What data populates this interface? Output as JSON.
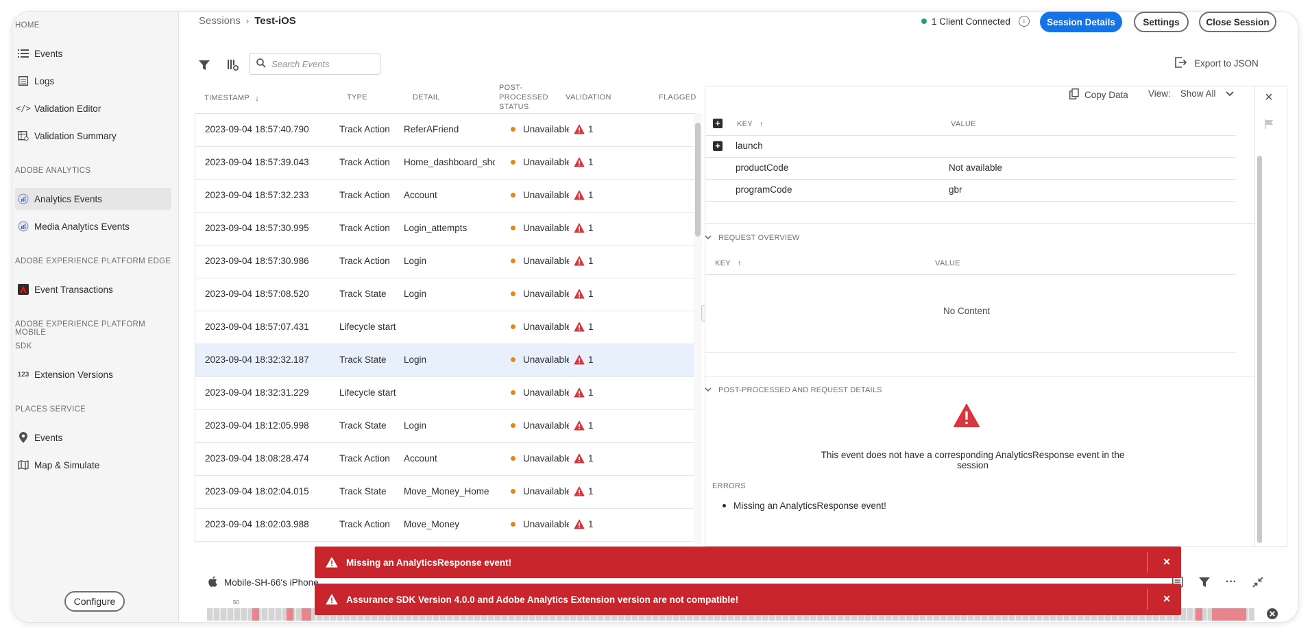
{
  "sidebar": {
    "sections": [
      {
        "title": "HOME",
        "items": [
          {
            "label": "Events",
            "icon": "list-icon"
          },
          {
            "label": "Logs",
            "icon": "log-icon"
          },
          {
            "label": "Validation Editor",
            "icon": "code-icon"
          },
          {
            "label": "Validation Summary",
            "icon": "summary-icon"
          }
        ]
      },
      {
        "title": "ADOBE ANALYTICS",
        "items": [
          {
            "label": "Analytics Events",
            "icon": "analytics-icon",
            "active": true
          },
          {
            "label": "Media Analytics Events",
            "icon": "media-analytics-icon"
          }
        ]
      },
      {
        "title": "ADOBE EXPERIENCE PLATFORM EDGE",
        "items": [
          {
            "label": "Event Transactions",
            "icon": "adobe-logo-icon"
          }
        ]
      },
      {
        "title": "ADOBE EXPERIENCE PLATFORM MOBILE",
        "title2": "SDK",
        "items": [
          {
            "label": "Extension Versions",
            "icon": "123-icon"
          }
        ]
      },
      {
        "title": "PLACES SERVICE",
        "items": [
          {
            "label": "Events",
            "icon": "pin-icon"
          },
          {
            "label": "Map & Simulate",
            "icon": "map-icon"
          }
        ]
      }
    ],
    "configure_label": "Configure"
  },
  "header": {
    "breadcrumb_root": "Sessions",
    "breadcrumb_current": "Test-iOS",
    "client_status": "1 Client Connected",
    "session_details_label": "Session Details",
    "settings_label": "Settings",
    "close_session_label": "Close Session"
  },
  "toolbar": {
    "search_placeholder": "Search Events",
    "export_label": "Export to JSON"
  },
  "table": {
    "columns": {
      "timestamp": "TIMESTAMP",
      "type": "TYPE",
      "detail": "DETAIL",
      "status_1": "POST-",
      "status_2": "PROCESSED",
      "status_3": "STATUS",
      "validation": "VALIDATION",
      "flagged": "FLAGGED"
    },
    "rows": [
      {
        "timestamp": "2023-09-04 18:57:40.790",
        "type": "Track Action",
        "detail": "ReferAFriend",
        "status": "Unavailable",
        "validation": "1"
      },
      {
        "timestamp": "2023-09-04 18:57:39.043",
        "type": "Track Action",
        "detail": "Home_dashboard_show",
        "status": "Unavailable",
        "validation": "1"
      },
      {
        "timestamp": "2023-09-04 18:57:32.233",
        "type": "Track Action",
        "detail": "Account",
        "status": "Unavailable",
        "validation": "1"
      },
      {
        "timestamp": "2023-09-04 18:57:30.995",
        "type": "Track Action",
        "detail": "Login_attempts",
        "status": "Unavailable",
        "validation": "1"
      },
      {
        "timestamp": "2023-09-04 18:57:30.986",
        "type": "Track Action",
        "detail": "Login",
        "status": "Unavailable",
        "validation": "1"
      },
      {
        "timestamp": "2023-09-04 18:57:08.520",
        "type": "Track State",
        "detail": "Login",
        "status": "Unavailable",
        "validation": "1"
      },
      {
        "timestamp": "2023-09-04 18:57:07.431",
        "type": "Lifecycle start",
        "detail": "",
        "status": "Unavailable",
        "validation": "1"
      },
      {
        "timestamp": "2023-09-04 18:32:32.187",
        "type": "Track State",
        "detail": "Login",
        "status": "Unavailable",
        "validation": "1",
        "selected": true
      },
      {
        "timestamp": "2023-09-04 18:32:31.229",
        "type": "Lifecycle start",
        "detail": "",
        "status": "Unavailable",
        "validation": "1"
      },
      {
        "timestamp": "2023-09-04 18:12:05.998",
        "type": "Track State",
        "detail": "Login",
        "status": "Unavailable",
        "validation": "1"
      },
      {
        "timestamp": "2023-09-04 18:08:28.474",
        "type": "Track Action",
        "detail": "Account",
        "status": "Unavailable",
        "validation": "1"
      },
      {
        "timestamp": "2023-09-04 18:02:04.015",
        "type": "Track State",
        "detail": "Move_Money_Home",
        "status": "Unavailable",
        "validation": "1"
      },
      {
        "timestamp": "2023-09-04 18:02:03.988",
        "type": "Track Action",
        "detail": "Move_Money",
        "status": "Unavailable",
        "validation": "1"
      }
    ]
  },
  "detail": {
    "copy_label": "Copy Data",
    "view_label": "View:",
    "view_value": "Show All",
    "key_header": "KEY",
    "value_header": "VALUE",
    "kv_rows": [
      {
        "key": "launch",
        "value": "",
        "expandable": true
      },
      {
        "key": "productCode",
        "value": "Not available"
      },
      {
        "key": "programCode",
        "value": "gbr"
      }
    ],
    "request_overview_title": "REQUEST OVERVIEW",
    "no_content": "No Content",
    "post_processed_title": "POST-PROCESSED AND REQUEST DETAILS",
    "error_message": "This event does not have a corresponding AnalyticsResponse event in the session",
    "errors_title": "ERRORS",
    "errors": [
      "Missing an AnalyticsResponse event!"
    ]
  },
  "bottom": {
    "device_label": "Mobile-SH-66's iPhone",
    "timeline_tick": "50"
  },
  "toasts": [
    "Missing an AnalyticsResponse event!",
    "Assurance SDK Version 4.0.0 and Adobe Analytics Extension version are not compatible!"
  ],
  "colors": {
    "accent": "#1473e6",
    "toast": "#c9252d",
    "warning": "#d7373f",
    "status_dot": "#e68619",
    "connected": "#2d9d78"
  }
}
